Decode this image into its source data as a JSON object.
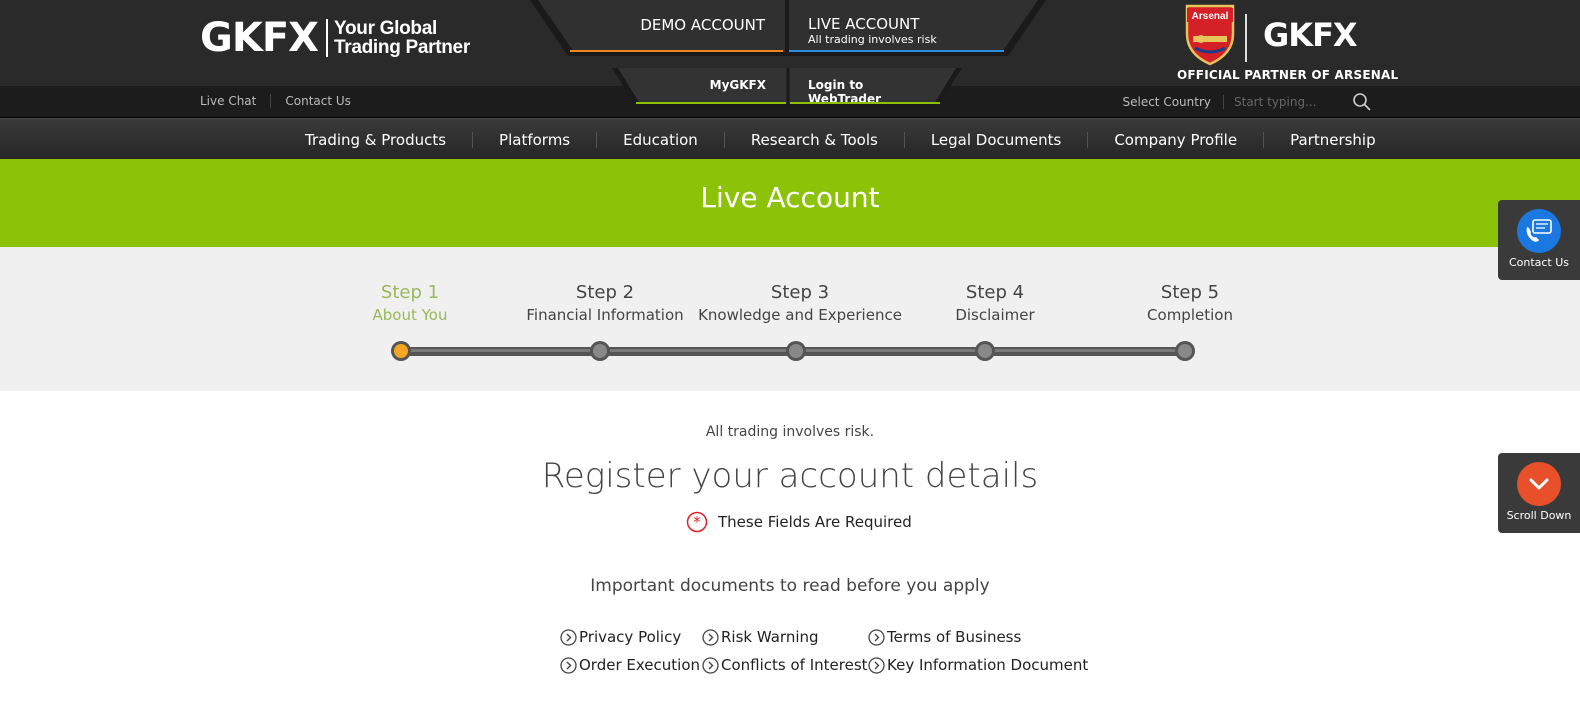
{
  "header": {
    "logo_text": "GKFX",
    "logo_tagline_1": "Your Global",
    "logo_tagline_2": "Trading Partner",
    "demo_tab": "DEMO ACCOUNT",
    "live_tab": "LIVE ACCOUNT",
    "live_tab_sub": "All trading involves risk",
    "partner_logo": "GKFX",
    "crest_text": "Arsenal",
    "partner_text": "OFFICIAL PARTNER OF ARSENAL"
  },
  "utility": {
    "live_chat": "Live Chat",
    "contact_us": "Contact Us",
    "mygkfx": "MyGKFX",
    "webtrader": "Login to WebTrader",
    "select_country": "Select Country",
    "search_placeholder": "Start typing..."
  },
  "nav": {
    "items": [
      "Trading & Products",
      "Platforms",
      "Education",
      "Research & Tools",
      "Legal Documents",
      "Company Profile",
      "Partnership"
    ]
  },
  "banner": {
    "title": "Live Account"
  },
  "steps": [
    {
      "num": "Step 1",
      "name": "About You",
      "active": true
    },
    {
      "num": "Step 2",
      "name": "Financial Information",
      "active": false
    },
    {
      "num": "Step 3",
      "name": "Knowledge and Experience",
      "active": false
    },
    {
      "num": "Step 4",
      "name": "Disclaimer",
      "active": false
    },
    {
      "num": "Step 5",
      "name": "Completion",
      "active": false
    }
  ],
  "content": {
    "risk_text": "All trading involves risk.",
    "title": "Register your account details",
    "required_text": "These Fields Are Required",
    "docs_title": "Important documents to read before you apply",
    "docs": [
      "Privacy Policy",
      "Risk Warning",
      "Terms of Business",
      "Order Execution",
      "Conflicts of Interest",
      "Key Information Document"
    ]
  },
  "floating": {
    "contact_label": "Contact Us",
    "scroll_label": "Scroll Down"
  },
  "colors": {
    "accent_green": "#8cc208",
    "demo_orange": "#f0841c",
    "live_blue": "#2a8fe0",
    "active_step": "#f5a623",
    "required_red": "#e0202a"
  }
}
